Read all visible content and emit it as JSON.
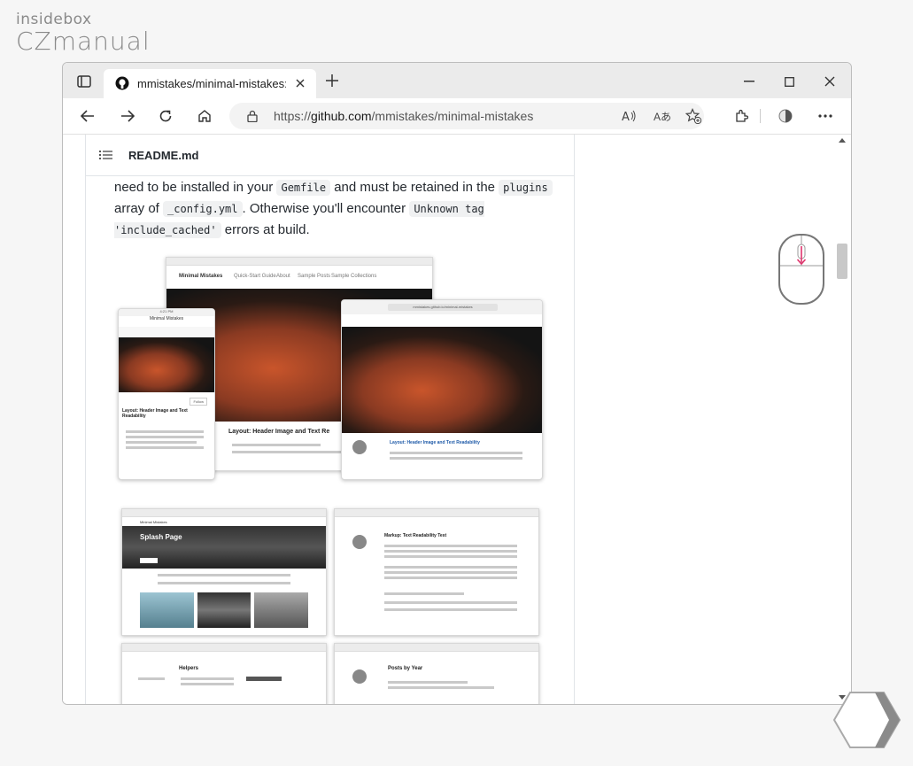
{
  "brand": {
    "line1": "insidebox",
    "line2": "CZmanual"
  },
  "browser": {
    "tab_title": "mmistakes/minimal-mistakes: Je",
    "url_prefix": "https://",
    "url_host": "github.com",
    "url_path": "/mmistakes/minimal-mistakes",
    "aa_label": "Aあ"
  },
  "readme": {
    "title": "README.md",
    "text1": "need to be installed in your ",
    "code1": "Gemfile",
    "text2": " and must be retained in the ",
    "code2": "plugins",
    "text3": " array of ",
    "code3": "_config.yml",
    "text4": ". Otherwise you'll encounter ",
    "code4": "Unknown tag 'include_cached'",
    "text5": " errors at build."
  },
  "screenshots": {
    "site_title": "Minimal Mistakes",
    "nav1": "Quick-Start Guide",
    "nav2": "About",
    "nav3": "Sample Posts",
    "nav4": "Sample Collections",
    "post_title": "Layout: Header Image and Text Re",
    "post_title_small": "Layout: Header Image and Text Readability",
    "splash_title": "Splash Page",
    "markup_title": "Markup: Text Readability Test",
    "helpers_title": "Helpers",
    "posts_title": "Posts by Year",
    "tablet_url": "mmistakes.github.io/minimal-mistakes",
    "follow": "Follow",
    "time": "4:21 PM"
  },
  "colors": {
    "accent_mouse": "#e0336c"
  }
}
